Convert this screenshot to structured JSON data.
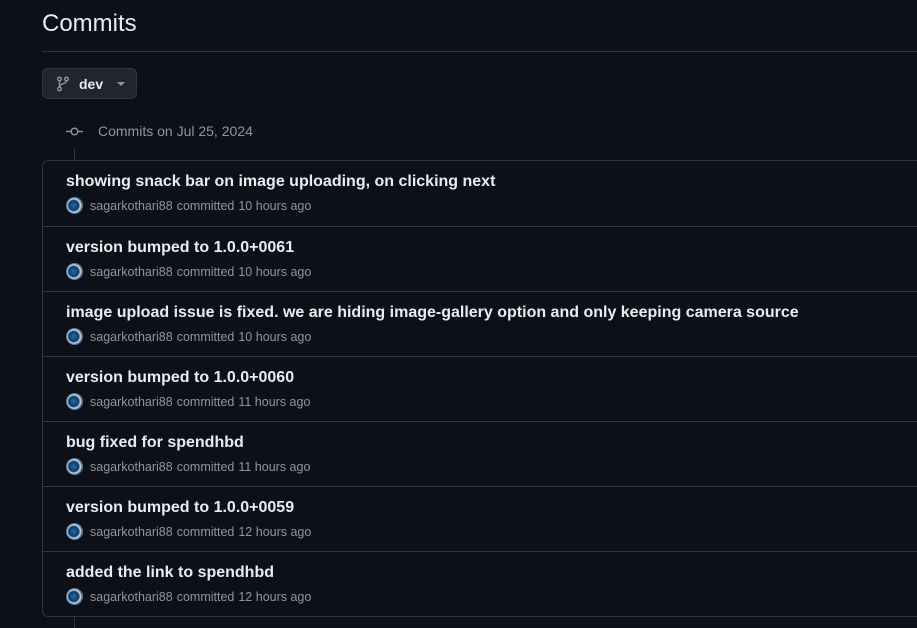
{
  "page": {
    "title": "Commits"
  },
  "branch_selector": {
    "label": "dev",
    "icon": "git-branch-icon"
  },
  "commit_group": {
    "icon": "git-commit-icon",
    "label": "Commits on Jul 25, 2024",
    "commits": [
      {
        "title": "showing snack bar on image uploading, on clicking next",
        "author": "sagarkothari88",
        "action": "committed",
        "time": "10 hours ago"
      },
      {
        "title": "version bumped to 1.0.0+0061",
        "author": "sagarkothari88",
        "action": "committed",
        "time": "10 hours ago"
      },
      {
        "title": "image upload issue is fixed. we are hiding image-gallery option and only keeping camera source",
        "author": "sagarkothari88",
        "action": "committed",
        "time": "10 hours ago"
      },
      {
        "title": "version bumped to 1.0.0+0060",
        "author": "sagarkothari88",
        "action": "committed",
        "time": "11 hours ago"
      },
      {
        "title": "bug fixed for spendhbd",
        "author": "sagarkothari88",
        "action": "committed",
        "time": "11 hours ago"
      },
      {
        "title": "version bumped to 1.0.0+0059",
        "author": "sagarkothari88",
        "action": "committed",
        "time": "12 hours ago"
      },
      {
        "title": "added the link to spendhbd",
        "author": "sagarkothari88",
        "action": "committed",
        "time": "12 hours ago"
      }
    ]
  },
  "colors": {
    "background": "#0d1117",
    "border": "#30363d",
    "text_primary": "#e6edf3",
    "text_muted": "#8d96a0",
    "button_bg": "#21262d"
  }
}
